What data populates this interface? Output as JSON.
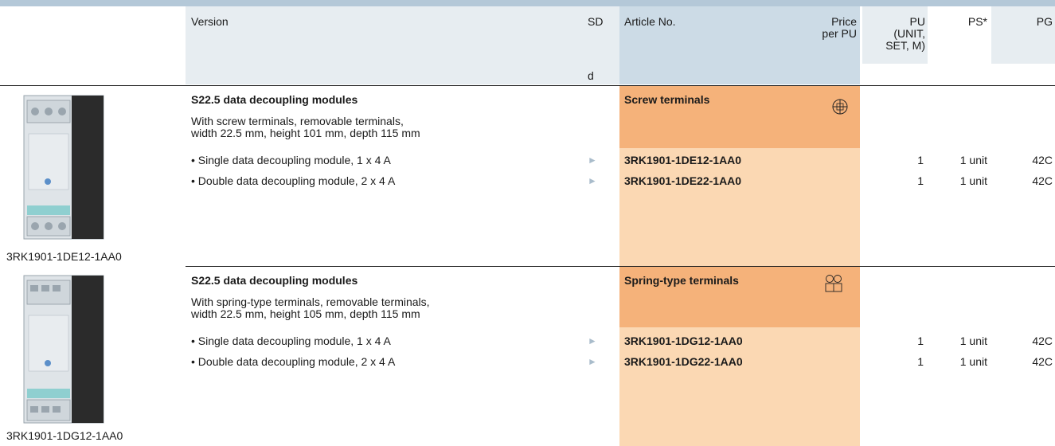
{
  "header": {
    "version": "Version",
    "sd": "SD",
    "sd_sub": "d",
    "article_no": "Article No.",
    "price_line1": "Price",
    "price_line2": "per PU",
    "pu_line1": "PU",
    "pu_line2": "(UNIT,",
    "pu_line3": "SET, M)",
    "ps": "PS*",
    "pg": "PG"
  },
  "sections": [
    {
      "title": "S22.5 data decoupling modules",
      "desc_line1": "With screw terminals, removable terminals,",
      "desc_line2": "width 22.5 mm, height 101 mm, depth 115 mm",
      "terminal_label": "Screw terminals",
      "terminal_icon": "screw-terminal-icon",
      "image_caption": "3RK1901-1DE12-1AA0",
      "rows": [
        {
          "version": "• Single data decoupling module, 1 x 4 A",
          "sd": "►",
          "article": "3RK1901-1DE12-1AA0",
          "pu": "1",
          "ps": "1 unit",
          "pg": "42C"
        },
        {
          "version": "• Double data decoupling module, 2 x 4 A",
          "sd": "►",
          "article": "3RK1901-1DE22-1AA0",
          "pu": "1",
          "ps": "1 unit",
          "pg": "42C"
        }
      ]
    },
    {
      "title": "S22.5 data decoupling modules",
      "desc_line1": "With spring-type terminals, removable terminals,",
      "desc_line2": "width 22.5 mm, height 105 mm, depth 115 mm",
      "terminal_label": "Spring-type terminals",
      "terminal_icon": "spring-terminal-icon",
      "image_caption": "3RK1901-1DG12-1AA0",
      "rows": [
        {
          "version": "• Single data decoupling module, 1 x 4 A",
          "sd": "►",
          "article": "3RK1901-1DG12-1AA0",
          "pu": "1",
          "ps": "1 unit",
          "pg": "42C"
        },
        {
          "version": "• Double data decoupling module, 2 x 4 A",
          "sd": "►",
          "article": "3RK1901-1DG22-1AA0",
          "pu": "1",
          "ps": "1 unit",
          "pg": "42C"
        }
      ]
    }
  ],
  "colors": {
    "header_bg": "#e7edf1",
    "article_header_bg": "#ccdbe6",
    "terminal_bg": "#f5b27a",
    "article_col_bg": "#fbd8b3",
    "arrow": "#a9bccb"
  }
}
